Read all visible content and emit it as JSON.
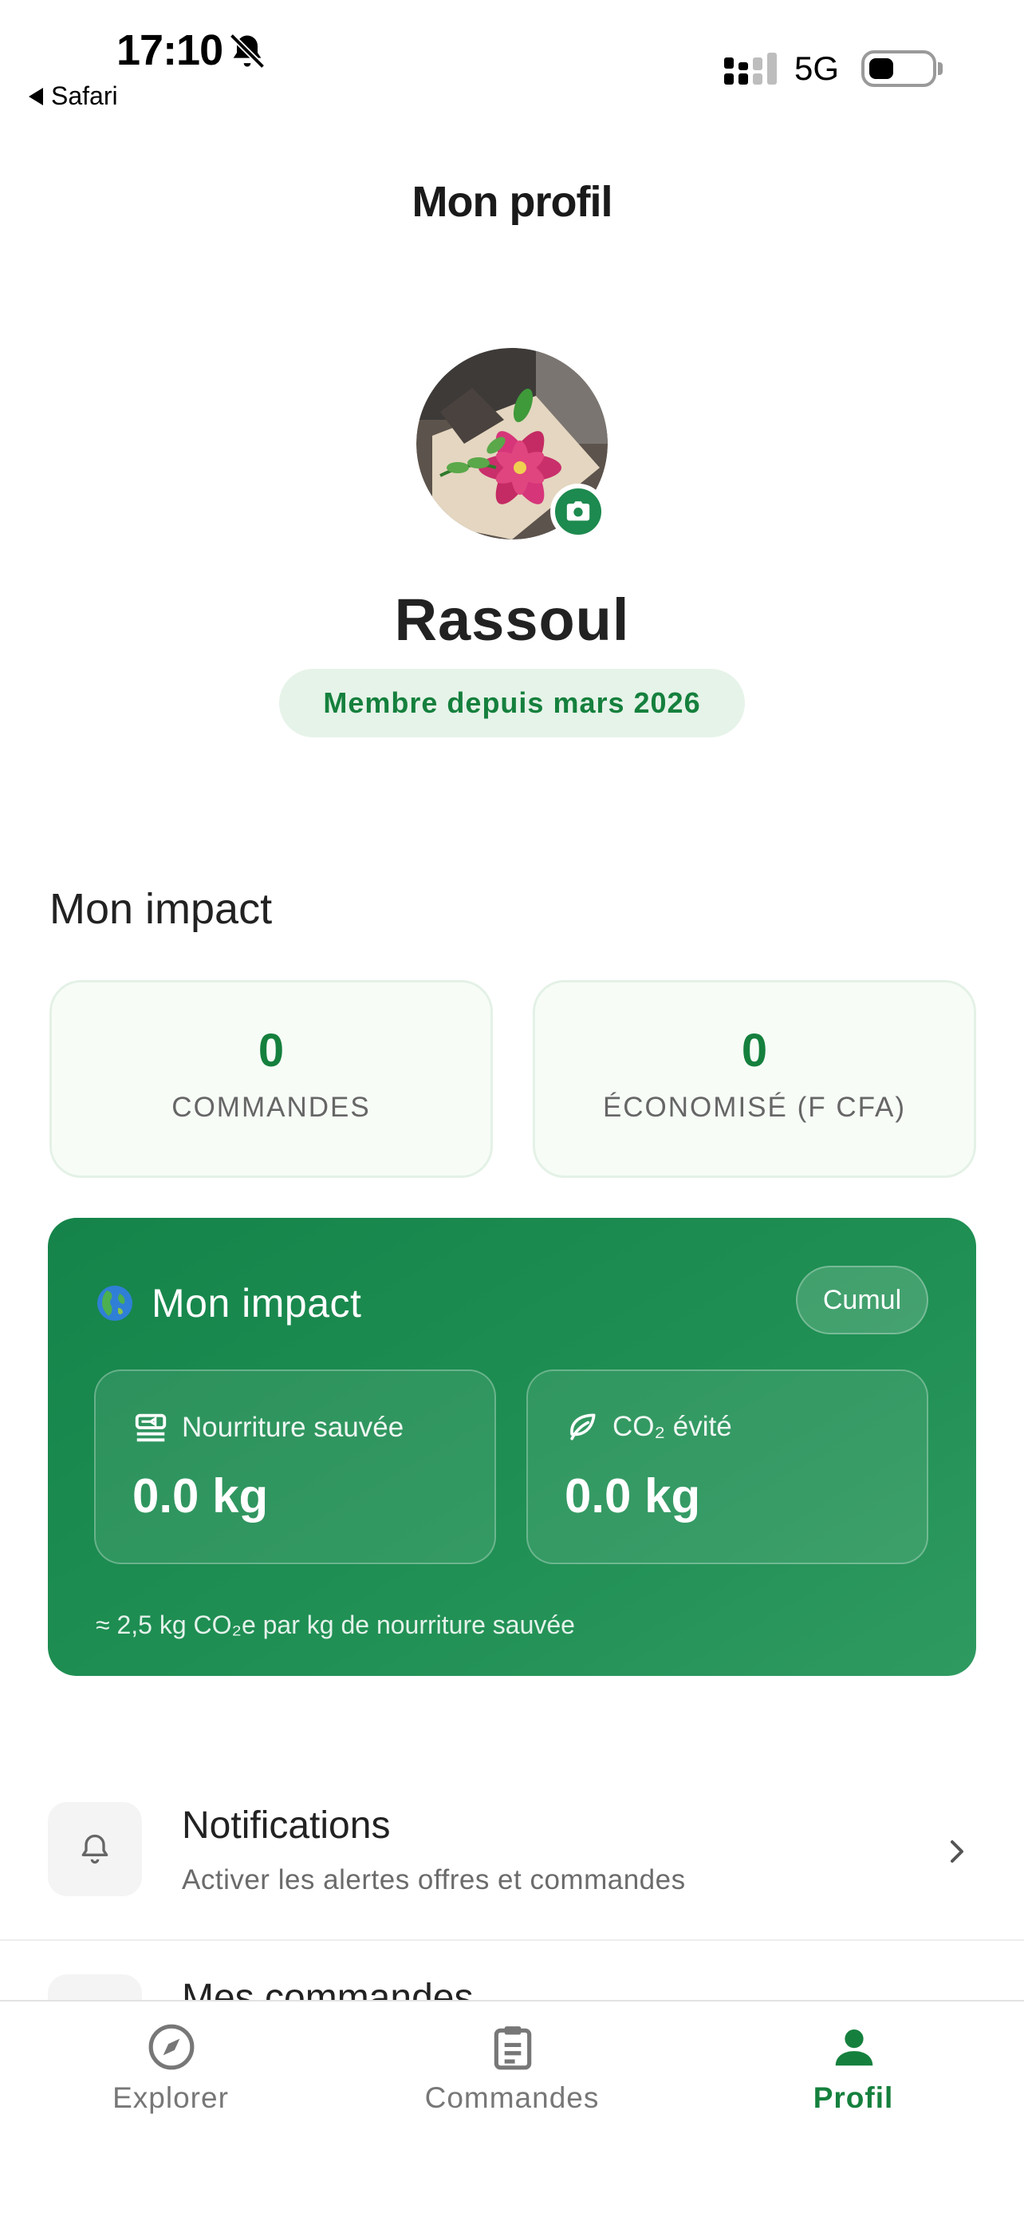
{
  "status_bar": {
    "time": "17:10",
    "back_label": "Safari",
    "network": "5G"
  },
  "header": {
    "title": "Mon profil"
  },
  "profile": {
    "name": "Rassoul",
    "member_since": "Membre depuis mars 2026"
  },
  "impact_section": {
    "title": "Mon impact",
    "stats": [
      {
        "value": "0",
        "label": "COMMANDES"
      },
      {
        "value": "0",
        "label": "ÉCONOMISÉ (F CFA)"
      }
    ]
  },
  "impact_card": {
    "title": "Mon impact",
    "badge": "Cumul",
    "food_saved": {
      "label": "Nourriture sauvée",
      "value": "0.0 kg"
    },
    "co2_avoided": {
      "label": "CO₂ évité",
      "value": "0.0 kg"
    },
    "note": "≈ 2,5 kg CO₂e par kg de nourriture sauvée"
  },
  "menu": [
    {
      "title": "Notifications",
      "subtitle": "Activer les alertes offres et commandes",
      "icon": "bell-icon"
    },
    {
      "title": "Mes commandes",
      "icon": "receipt-icon"
    }
  ],
  "tabs": [
    {
      "label": "Explorer",
      "icon": "compass-icon",
      "active": false
    },
    {
      "label": "Commandes",
      "icon": "clipboard-icon",
      "active": false
    },
    {
      "label": "Profil",
      "icon": "person-icon",
      "active": true
    }
  ],
  "colors": {
    "accent": "#15803d",
    "impact_card": "#1b8a4d",
    "pill_bg": "#e6f3e9"
  }
}
